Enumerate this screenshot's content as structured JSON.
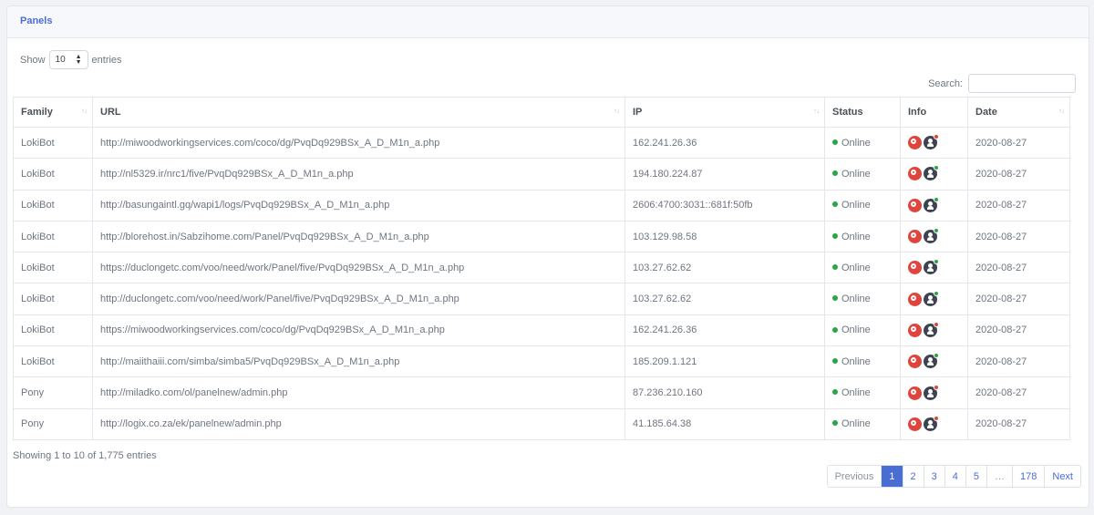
{
  "header": {
    "title": "Panels"
  },
  "length": {
    "show_label": "Show",
    "value": "10",
    "entries_label": "entries"
  },
  "search": {
    "label": "Search:",
    "value": ""
  },
  "table": {
    "columns": [
      "Family",
      "URL",
      "IP",
      "Status",
      "Info",
      "Date"
    ],
    "rows": [
      {
        "family": "LokiBot",
        "url": "http://miwoodworkingservices.com/coco/dg/PvqDq929BSx_A_D_M1n_a.php",
        "ip": "162.241.26.36",
        "status": "Online",
        "badge": "#e0443c",
        "date": "2020-08-27"
      },
      {
        "family": "LokiBot",
        "url": "http://nl5329.ir/nrc1/five/PvqDq929BSx_A_D_M1n_a.php",
        "ip": "194.180.224.87",
        "status": "Online",
        "badge": "#28a745",
        "date": "2020-08-27"
      },
      {
        "family": "LokiBot",
        "url": "http://basungaintl.gq/wapi1/logs/PvqDq929BSx_A_D_M1n_a.php",
        "ip": "2606:4700:3031::681f:50fb",
        "status": "Online",
        "badge": "#28a745",
        "date": "2020-08-27"
      },
      {
        "family": "LokiBot",
        "url": "http://blorehost.in/Sabzihome.com/Panel/PvqDq929BSx_A_D_M1n_a.php",
        "ip": "103.129.98.58",
        "status": "Online",
        "badge": "#28a745",
        "date": "2020-08-27"
      },
      {
        "family": "LokiBot",
        "url": "https://duclongetc.com/voo/need/work/Panel/five/PvqDq929BSx_A_D_M1n_a.php",
        "ip": "103.27.62.62",
        "status": "Online",
        "badge": "#28a745",
        "date": "2020-08-27"
      },
      {
        "family": "LokiBot",
        "url": "http://duclongetc.com/voo/need/work/Panel/five/PvqDq929BSx_A_D_M1n_a.php",
        "ip": "103.27.62.62",
        "status": "Online",
        "badge": "#28a745",
        "date": "2020-08-27"
      },
      {
        "family": "LokiBot",
        "url": "https://miwoodworkingservices.com/coco/dg/PvqDq929BSx_A_D_M1n_a.php",
        "ip": "162.241.26.36",
        "status": "Online",
        "badge": "#e0443c",
        "date": "2020-08-27"
      },
      {
        "family": "LokiBot",
        "url": "http://maiithaiii.com/simba/simba5/PvqDq929BSx_A_D_M1n_a.php",
        "ip": "185.209.1.121",
        "status": "Online",
        "badge": "#28a745",
        "date": "2020-08-27"
      },
      {
        "family": "Pony",
        "url": "http://miladko.com/ol/panelnew/admin.php",
        "ip": "87.236.210.160",
        "status": "Online",
        "badge": "#e0443c",
        "date": "2020-08-27"
      },
      {
        "family": "Pony",
        "url": "http://logix.co.za/ek/panelnew/admin.php",
        "ip": "41.185.64.38",
        "status": "Online",
        "badge": "#e0443c",
        "date": "2020-08-27"
      }
    ]
  },
  "footer": {
    "info": "Showing 1 to 10 of 1,775 entries"
  },
  "pagination": {
    "previous": "Previous",
    "pages": [
      "1",
      "2",
      "3",
      "4",
      "5",
      "…",
      "178"
    ],
    "active": "1",
    "next": "Next"
  },
  "colors": {
    "accent": "#4a6dd3",
    "online": "#28a745",
    "search_icon": "#e0443c",
    "user_icon": "#3d4450"
  },
  "icons": {
    "info_search": "search-icon",
    "info_user": "user-icon"
  }
}
